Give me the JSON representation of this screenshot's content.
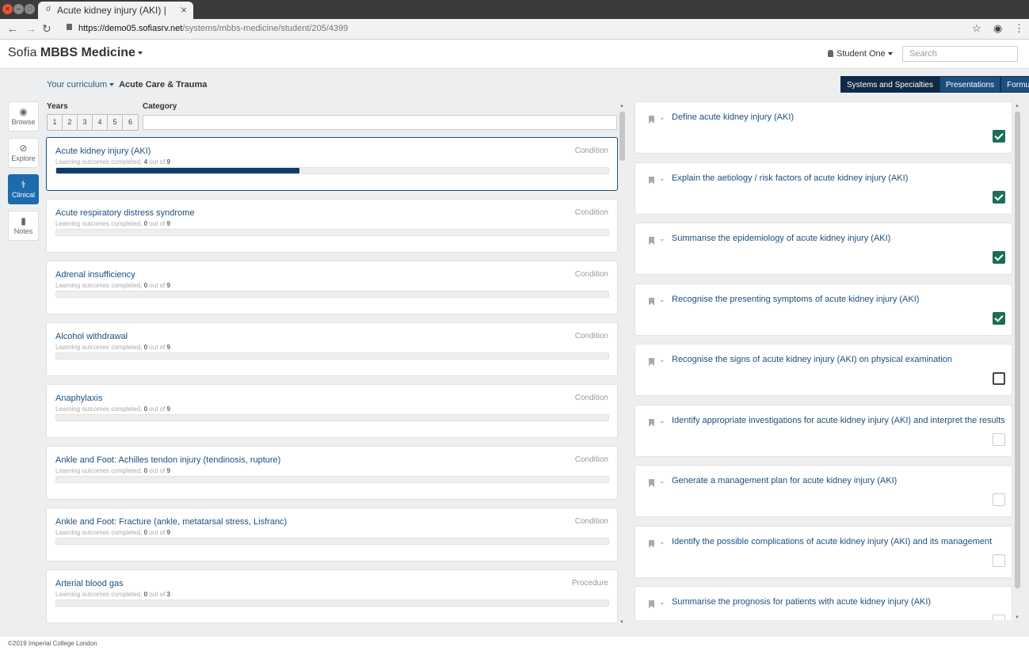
{
  "browser": {
    "tab_title": "Acute kidney injury (AKI) |",
    "tab_icon": "σ",
    "url_domain": "https://demo05.sofiasrv.net",
    "url_path": "/systems/mbbs-medicine/student/205/4399"
  },
  "app": {
    "brand_light": "Sofia",
    "brand_bold": "MBBS Medicine",
    "user": "Student One",
    "search_placeholder": "Search"
  },
  "curriculum": {
    "link": "Your curriculum",
    "current": "Acute Care & Trauma"
  },
  "view_tabs": [
    "Systems and Specialties",
    "Presentations",
    "Formulary"
  ],
  "sidenav": [
    {
      "label": "Browse",
      "icon": "eye-icon"
    },
    {
      "label": "Explore",
      "icon": "compass-icon"
    },
    {
      "label": "Clinical",
      "icon": "doctor-icon"
    },
    {
      "label": "Notes",
      "icon": "bookmark-icon"
    }
  ],
  "filters": {
    "years_label": "Years",
    "years": [
      "1",
      "2",
      "3",
      "4",
      "5",
      "6"
    ],
    "category_label": "Category"
  },
  "progress_prefix": "Learning outcomes completed, ",
  "progress_mid": " out of ",
  "conditions": [
    {
      "title": "Acute kidney injury (AKI)",
      "type": "Condition",
      "done": "4",
      "total": "9",
      "progress": 0.44
    },
    {
      "title": "Acute respiratory distress syndrome",
      "type": "Condition",
      "done": "0",
      "total": "9",
      "progress": 0
    },
    {
      "title": "Adrenal insufficiency",
      "type": "Condition",
      "done": "0",
      "total": "9",
      "progress": 0
    },
    {
      "title": "Alcohol withdrawal",
      "type": "Condition",
      "done": "0",
      "total": "9",
      "progress": 0
    },
    {
      "title": "Anaphylaxis",
      "type": "Condition",
      "done": "0",
      "total": "9",
      "progress": 0
    },
    {
      "title": "Ankle and Foot: Achilles tendon injury (tendinosis, rupture)",
      "type": "Condition",
      "done": "0",
      "total": "9",
      "progress": 0
    },
    {
      "title": "Ankle and Foot: Fracture (ankle, metatarsal stress, Lisfranc)",
      "type": "Condition",
      "done": "0",
      "total": "9",
      "progress": 0
    },
    {
      "title": "Arterial blood gas",
      "type": "Procedure",
      "done": "0",
      "total": "3",
      "progress": 0
    }
  ],
  "outcomes": [
    {
      "text": "Define acute kidney injury (AKI)",
      "checked": true
    },
    {
      "text": "Explain the aetiology / risk factors of acute kidney injury (AKI)",
      "checked": true
    },
    {
      "text": "Summarise the epidemiology of acute kidney injury (AKI)",
      "checked": true
    },
    {
      "text": "Recognise the presenting symptoms of acute kidney injury (AKI)",
      "checked": true
    },
    {
      "text": "Recognise the signs of acute kidney injury (AKI) on physical examination",
      "checked": false,
      "hover": true
    },
    {
      "text": "Identify appropriate investigations for acute kidney injury (AKI) and interpret the results",
      "checked": false
    },
    {
      "text": "Generate a management plan for acute kidney injury (AKI)",
      "checked": false
    },
    {
      "text": "Identify the possible complications of acute kidney injury (AKI) and its management",
      "checked": false
    },
    {
      "text": "Summarise the prognosis for patients with acute kidney injury (AKI)",
      "checked": false
    }
  ],
  "footer": "©2019 Imperial College London",
  "colors": {
    "accent": "#1d4f7d",
    "check": "#1c6e57",
    "active_nav": "#1d6aae"
  }
}
